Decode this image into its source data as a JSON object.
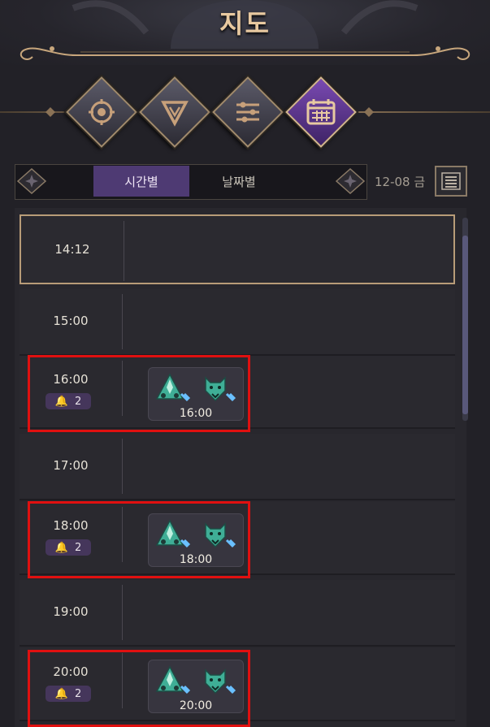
{
  "header": {
    "title": "지도"
  },
  "category_tabs": [
    {
      "name": "compass",
      "active": false
    },
    {
      "name": "triangle",
      "active": false
    },
    {
      "name": "filter",
      "active": false
    },
    {
      "name": "calendar",
      "active": true
    }
  ],
  "view_toggle": {
    "by_time": "시간별",
    "by_date": "날짜별",
    "selected": "시간별"
  },
  "date_label": "12-08 금",
  "timeline": {
    "current_time": "14:12",
    "rows": [
      {
        "time": "15:00"
      },
      {
        "time": "16:00",
        "badge": "2",
        "event_time": "16:00"
      },
      {
        "time": "17:00"
      },
      {
        "time": "18:00",
        "badge": "2",
        "event_time": "18:00"
      },
      {
        "time": "19:00"
      },
      {
        "time": "20:00",
        "badge": "2",
        "event_time": "20:00"
      }
    ]
  },
  "colors": {
    "accent_purple": "#4e3a73",
    "gold": "#b89c78",
    "highlight_red": "#e01010",
    "event_icon_teal": "#3fae96"
  }
}
